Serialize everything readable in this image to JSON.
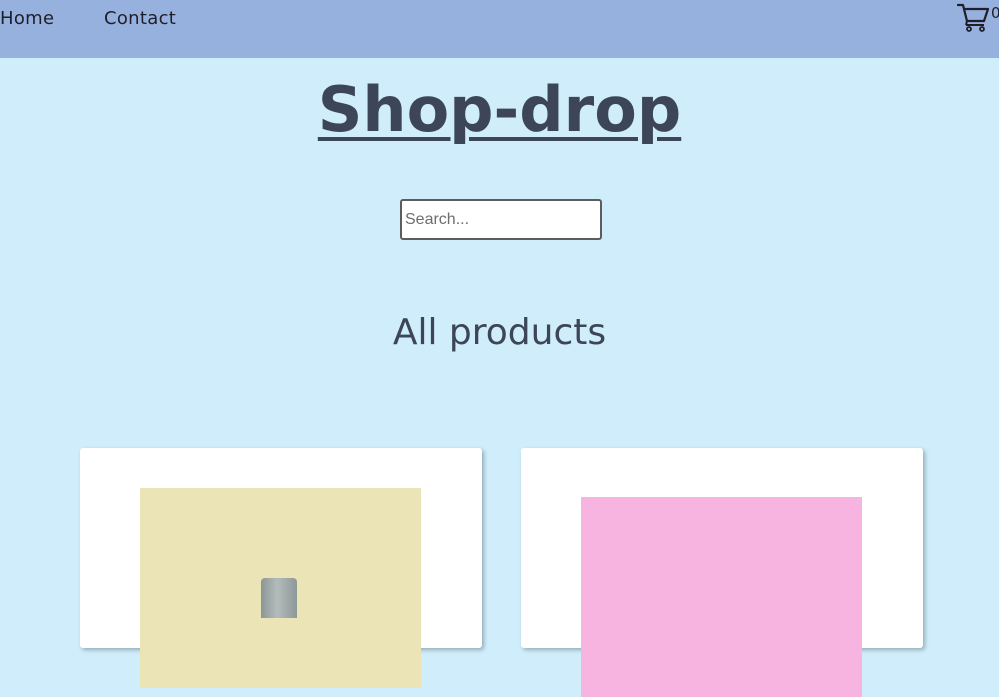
{
  "nav": {
    "home_label": "Home",
    "contact_label": "Contact",
    "cart_count": "0"
  },
  "header": {
    "title": "Shop-drop"
  },
  "search": {
    "placeholder": "Search..."
  },
  "main": {
    "section_title": "All products",
    "products": [
      {
        "image_color": "#ebe4b7"
      },
      {
        "image_color": "#f8b4e1"
      }
    ]
  },
  "colors": {
    "navbar": "#97b1df",
    "background": "#cfedfb",
    "heading": "#3d4658",
    "card": "#ffffff"
  },
  "icons": {
    "cart": "shopping-cart-icon"
  }
}
